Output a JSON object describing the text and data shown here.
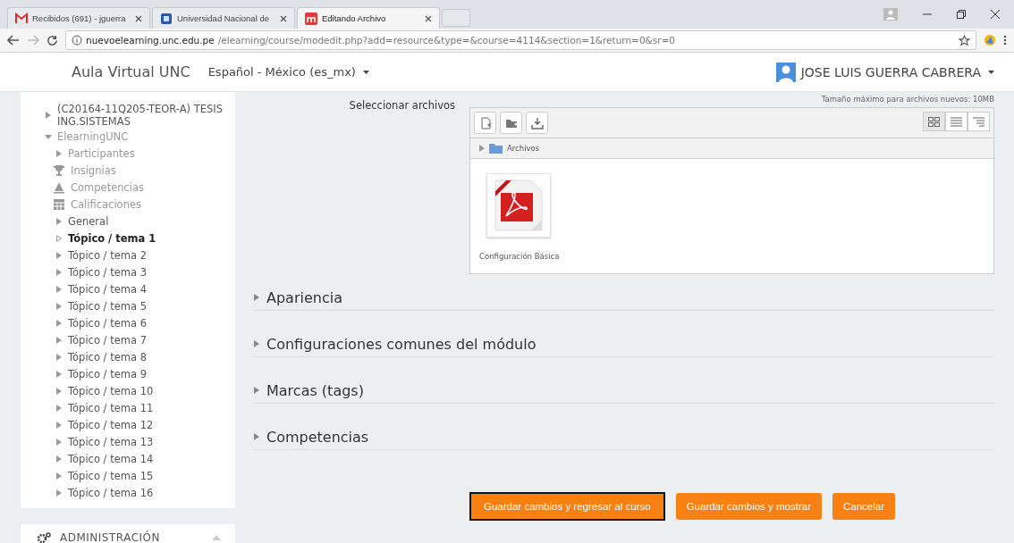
{
  "browser": {
    "tabs": [
      {
        "kind": "mail",
        "title": "Recibidos (691) - jguerra",
        "selected": false
      },
      {
        "kind": "site",
        "title": "Universidad Nacional de",
        "selected": false
      },
      {
        "kind": "moodle",
        "title": "Editando Archivo",
        "selected": true
      }
    ],
    "url": {
      "host": "nuevoelearning.unc.edu.pe",
      "path": "/elearning/course/modedit.php?add=resource&type=&course=4114&section=1&return=0&sr=0"
    }
  },
  "navbar": {
    "brand": "Aula Virtual UNC",
    "language": "Español - México (es_mx)",
    "user": "JOSE LUIS GUERRA CABRERA"
  },
  "sidebar": {
    "items": [
      {
        "kind": "branch",
        "label": "(C20164-11Q205-TEOR-A) TESIS ING.SISTEMAS",
        "expanded": false,
        "selected": false
      },
      {
        "kind": "branch",
        "label": "ElearningUNC",
        "expanded": true,
        "selected": false,
        "children": [
          {
            "kind": "branch",
            "label": "Participantes",
            "expanded": false,
            "selected": false
          },
          {
            "kind": "trophy",
            "label": "Insignias",
            "selected": false
          },
          {
            "kind": "competency",
            "label": "Competencias",
            "selected": false
          },
          {
            "kind": "grades",
            "label": "Calificaciones",
            "selected": false
          },
          {
            "kind": "branch",
            "label": "General",
            "expanded": false,
            "selected": false
          },
          {
            "kind": "branch",
            "label": "Tópico / tema 1",
            "expanded": false,
            "selected": true
          },
          {
            "kind": "branch",
            "label": "Tópico / tema 2",
            "expanded": false,
            "selected": false
          },
          {
            "kind": "branch",
            "label": "Tópico / tema 3",
            "expanded": false,
            "selected": false
          },
          {
            "kind": "branch",
            "label": "Tópico / tema 4",
            "expanded": false,
            "selected": false
          },
          {
            "kind": "branch",
            "label": "Tópico / tema 5",
            "expanded": false,
            "selected": false
          },
          {
            "kind": "branch",
            "label": "Tópico / tema 6",
            "expanded": false,
            "selected": false
          },
          {
            "kind": "branch",
            "label": "Tópico / tema 7",
            "expanded": false,
            "selected": false
          },
          {
            "kind": "branch",
            "label": "Tópico / tema 8",
            "expanded": false,
            "selected": false
          },
          {
            "kind": "branch",
            "label": "Tópico / tema 9",
            "expanded": false,
            "selected": false
          },
          {
            "kind": "branch",
            "label": "Tópico / tema 10",
            "expanded": false,
            "selected": false
          },
          {
            "kind": "branch",
            "label": "Tópico / tema 11",
            "expanded": false,
            "selected": false
          },
          {
            "kind": "branch",
            "label": "Tópico / tema 12",
            "expanded": false,
            "selected": false
          },
          {
            "kind": "branch",
            "label": "Tópico / tema 13",
            "expanded": false,
            "selected": false
          },
          {
            "kind": "branch",
            "label": "Tópico / tema 14",
            "expanded": false,
            "selected": false
          },
          {
            "kind": "branch",
            "label": "Tópico / tema 15",
            "expanded": false,
            "selected": false
          },
          {
            "kind": "branch",
            "label": "Tópico / tema 16",
            "expanded": false,
            "selected": false
          }
        ]
      }
    ],
    "admin_block": {
      "title": "ADMINISTRACIÓN"
    }
  },
  "file_picker": {
    "label": "Seleccionar archivos",
    "max_size": "Tamaño máximo para archivos nuevos: 10MB",
    "folder": "Archivos",
    "files": [
      {
        "name": "Configuración Básica"
      }
    ]
  },
  "sections": [
    {
      "title": "Apariencia",
      "expanded": false
    },
    {
      "title": "Configuraciones comunes del módulo",
      "expanded": false
    },
    {
      "title": "Marcas (tags)",
      "expanded": false
    },
    {
      "title": "Competencias",
      "expanded": false
    }
  ],
  "buttons": [
    {
      "label": "Guardar cambios y regresar al curso",
      "focused": true
    },
    {
      "label": "Guardar cambios y mostrar",
      "focused": false
    },
    {
      "label": "Cancelar",
      "focused": false
    }
  ]
}
